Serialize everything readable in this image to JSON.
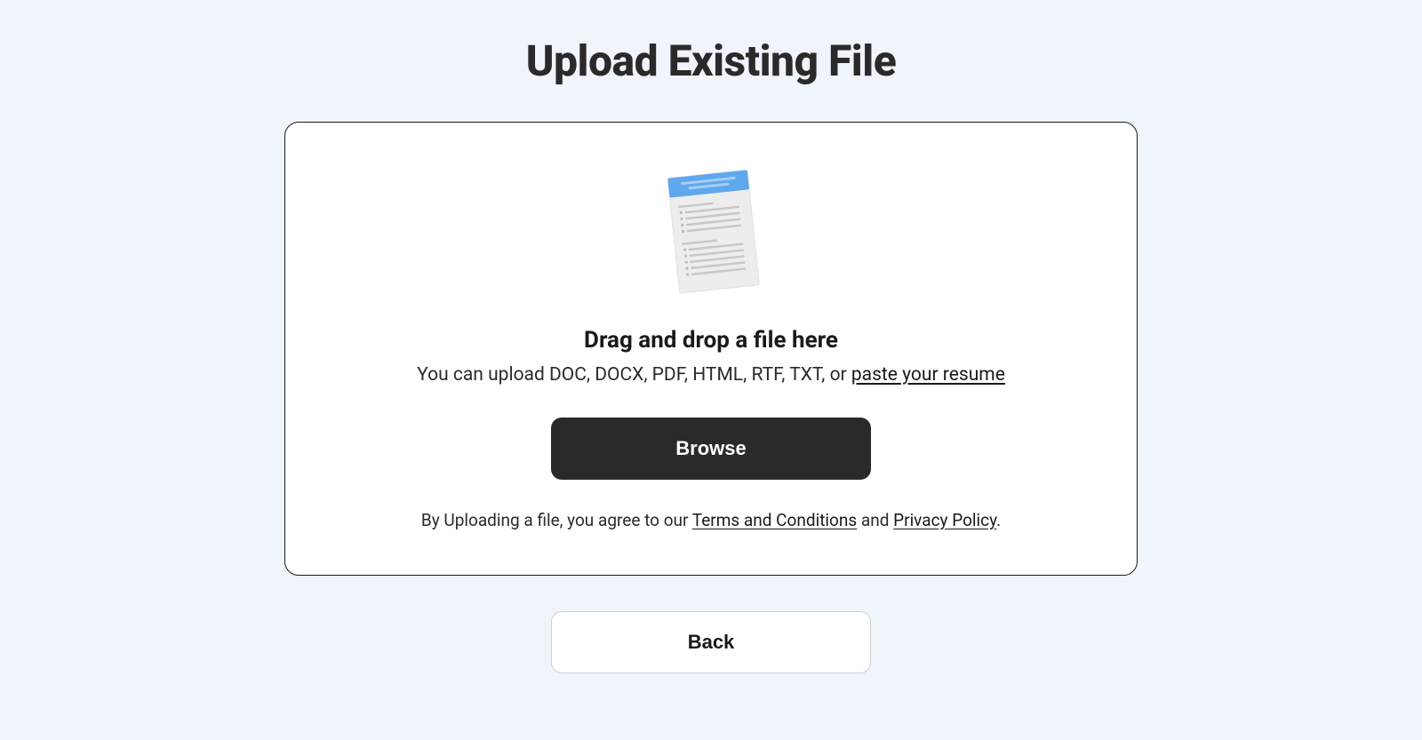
{
  "page": {
    "title": "Upload Existing File"
  },
  "dropzone": {
    "heading": "Drag and drop a file here",
    "subtext_prefix": "You can upload DOC, DOCX, PDF, HTML, RTF, TXT, or ",
    "paste_link": "paste your resume"
  },
  "buttons": {
    "browse": "Browse",
    "back": "Back"
  },
  "legal": {
    "prefix": "By Uploading a file, you agree to our ",
    "terms_label": "Terms and Conditions",
    "middle": " and ",
    "privacy_label": "Privacy Policy",
    "suffix": "."
  }
}
